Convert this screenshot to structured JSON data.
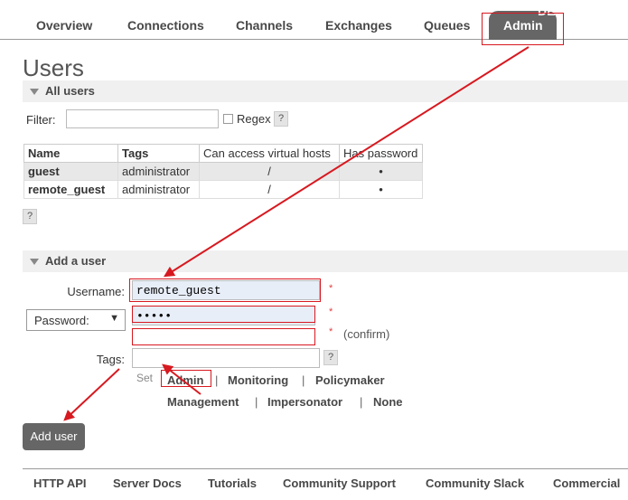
{
  "nav": {
    "items": [
      "Overview",
      "Connections",
      "Channels",
      "Exchanges",
      "Queues"
    ],
    "active": "Admin",
    "overflow": "DE"
  },
  "page_title": "Users",
  "all_users": {
    "heading": "All users",
    "filter_label": "Filter:",
    "filter_value": "",
    "regex_label": "Regex",
    "help": "?",
    "table": {
      "headers": [
        "Name",
        "Tags",
        "Can access virtual hosts",
        "Has password"
      ],
      "rows": [
        {
          "name": "guest",
          "tags": "administrator",
          "vhosts": "/",
          "has_password": "•"
        },
        {
          "name": "remote_guest",
          "tags": "administrator",
          "vhosts": "/",
          "has_password": "•"
        }
      ]
    },
    "table_help": "?"
  },
  "add_user": {
    "heading": "Add a user",
    "username_label": "Username:",
    "username_value": "remote_guest",
    "password_select": "Password:",
    "password_value": "•••••",
    "confirm_value": "",
    "confirm_label": "(confirm)",
    "required_mark": "*",
    "tags_label": "Tags:",
    "tags_value": "",
    "tags_help": "?",
    "set_label": "Set",
    "tag_options": [
      "Admin",
      "Monitoring",
      "Policymaker",
      "Management",
      "Impersonator",
      "None"
    ],
    "separator": "|",
    "submit": "Add user"
  },
  "footer": {
    "items": [
      "HTTP API",
      "Server Docs",
      "Tutorials",
      "Community Support",
      "Community Slack",
      "Commercial"
    ]
  },
  "annotation_color": "#d71920"
}
